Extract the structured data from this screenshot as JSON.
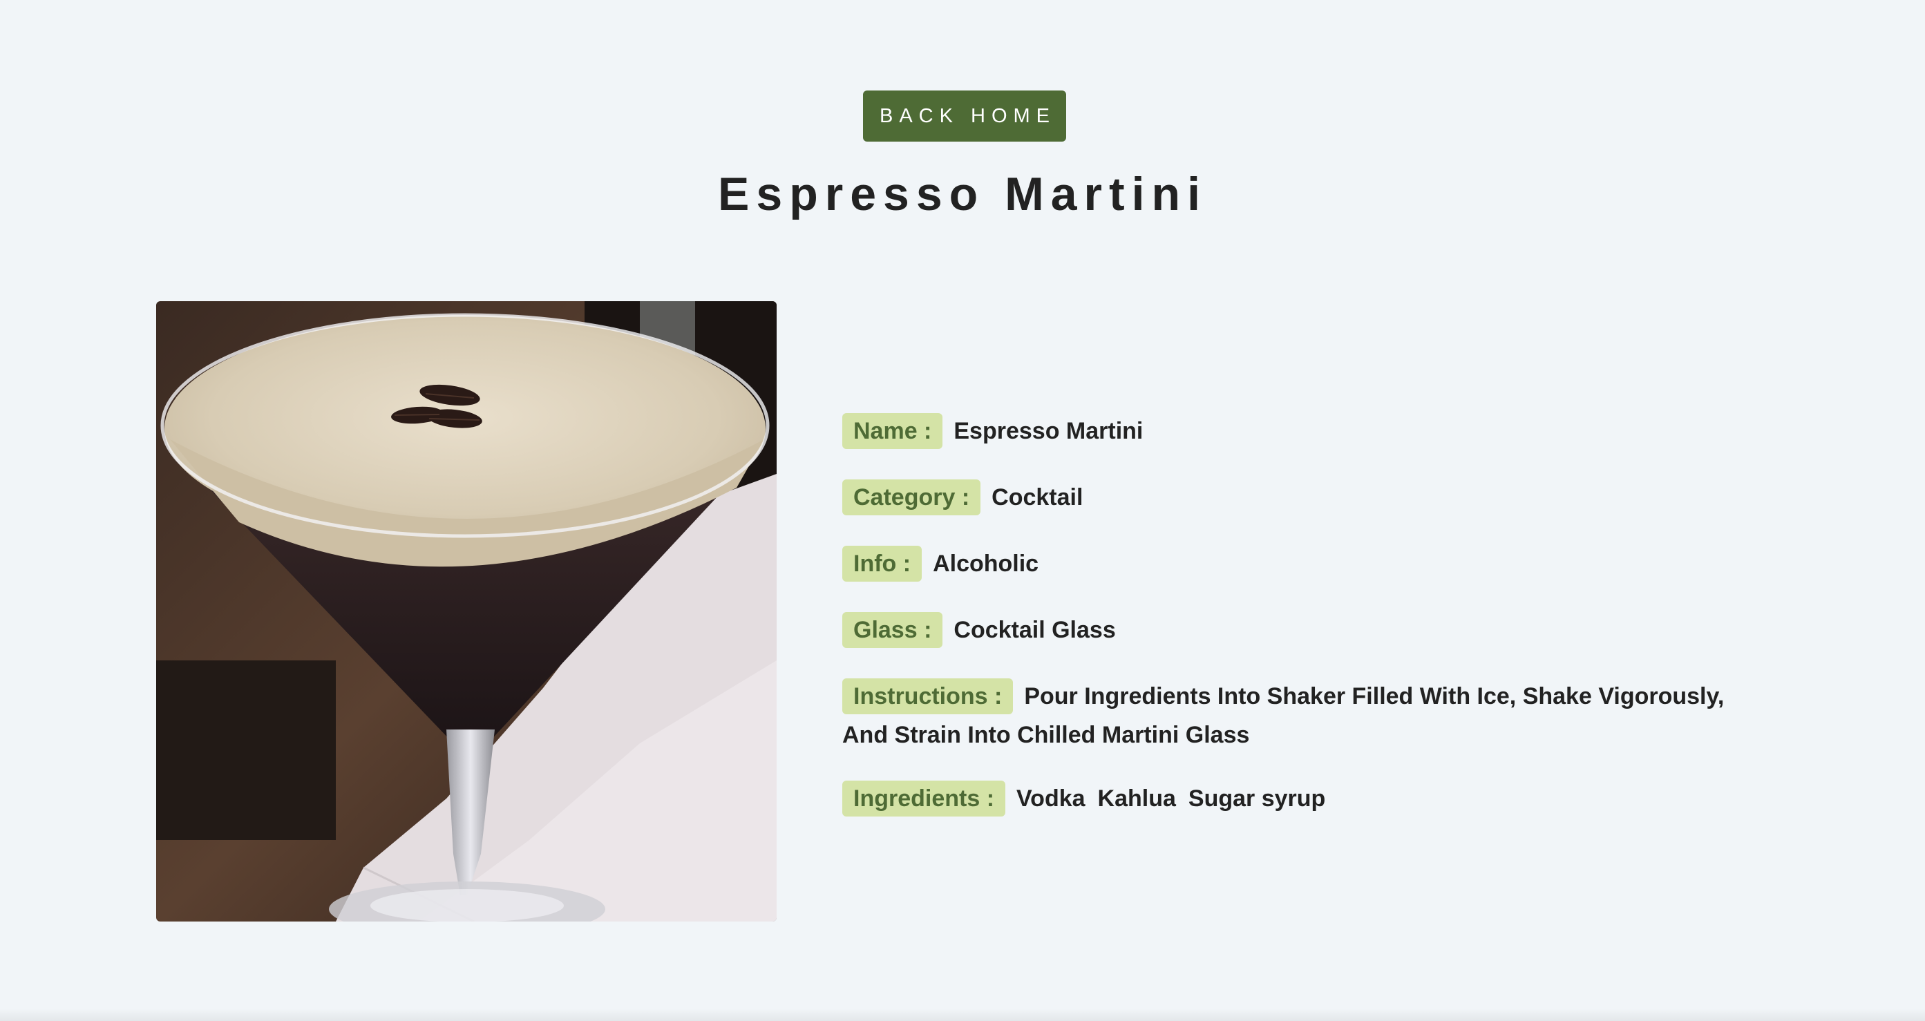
{
  "nav": {
    "back_label": "BACK HOME"
  },
  "cocktail": {
    "title": "Espresso Martini",
    "image_icon": "espresso-martini-photo",
    "details": [
      {
        "label": "Name :",
        "value": "Espresso Martini"
      },
      {
        "label": "Category :",
        "value": "Cocktail"
      },
      {
        "label": "Info :",
        "value": "Alcoholic"
      },
      {
        "label": "Glass :",
        "value": "Cocktail Glass"
      },
      {
        "label": "Instructions :",
        "value": "Pour Ingredients Into Shaker Filled With Ice, Shake Vigorously, And Strain Into Chilled Martini Glass"
      }
    ],
    "ingredients_label": "Ingredients :",
    "ingredients": [
      "Vodka",
      "Kahlua",
      "Sugar syrup"
    ]
  },
  "colors": {
    "background": "#f1f5f8",
    "accent": "#4e6b35",
    "label_bg": "#d4e3a6",
    "text": "#222222"
  }
}
